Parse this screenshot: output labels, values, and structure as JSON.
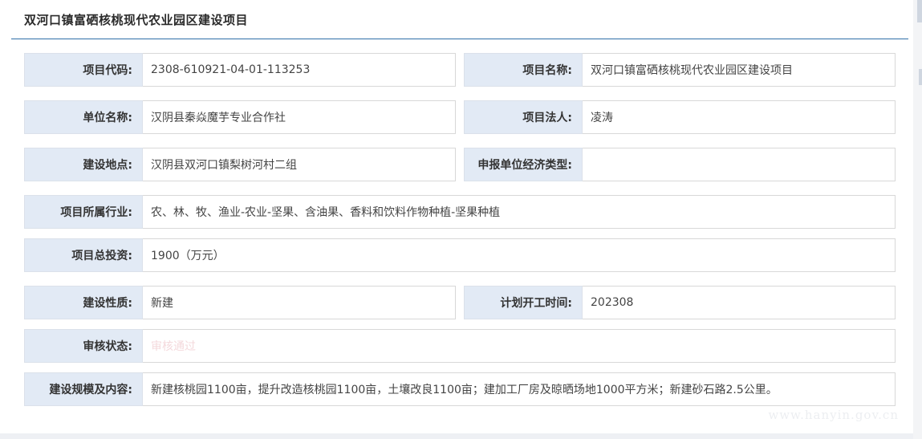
{
  "panel": {
    "title": "双河口镇富硒核桃现代农业园区建设项目"
  },
  "fields": {
    "project_code": {
      "label": "项目代码:",
      "value": "2308-610921-04-01-113253"
    },
    "project_name": {
      "label": "项目名称:",
      "value": "双河口镇富硒核桃现代农业园区建设项目"
    },
    "unit_name": {
      "label": "单位名称:",
      "value": "汉阴县秦焱魔芋专业合作社"
    },
    "legal_person": {
      "label": "项目法人:",
      "value": "凌涛"
    },
    "location": {
      "label": "建设地点:",
      "value": "汉阴县双河口镇梨树河村二组"
    },
    "economic_type": {
      "label": "申报单位经济类型:",
      "value": ""
    },
    "industry": {
      "label": "项目所属行业:",
      "value": "农、林、牧、渔业-农业-坚果、含油果、香料和饮料作物种植-坚果种植"
    },
    "investment": {
      "label": "项目总投资:",
      "value": "1900（万元）"
    },
    "nature": {
      "label": "建设性质:",
      "value": "新建"
    },
    "start_time": {
      "label": "计划开工时间:",
      "value": "202308"
    },
    "review_status": {
      "label": "审核状态:",
      "value": "审核通过"
    },
    "scale_content": {
      "label": "建设规模及内容:",
      "value": "新建核桃园1100亩，提升改造核桃园1100亩，土壤改良1100亩；建加工厂房及晾晒场地1000平方米；新建砂石路2.5公里。"
    }
  },
  "watermark": "www.hanyin.gov.cn",
  "colors": {
    "label_bg": "#e2eaf5",
    "header_rule": "#2f6fa7",
    "status_text": "#f4d9dc"
  }
}
